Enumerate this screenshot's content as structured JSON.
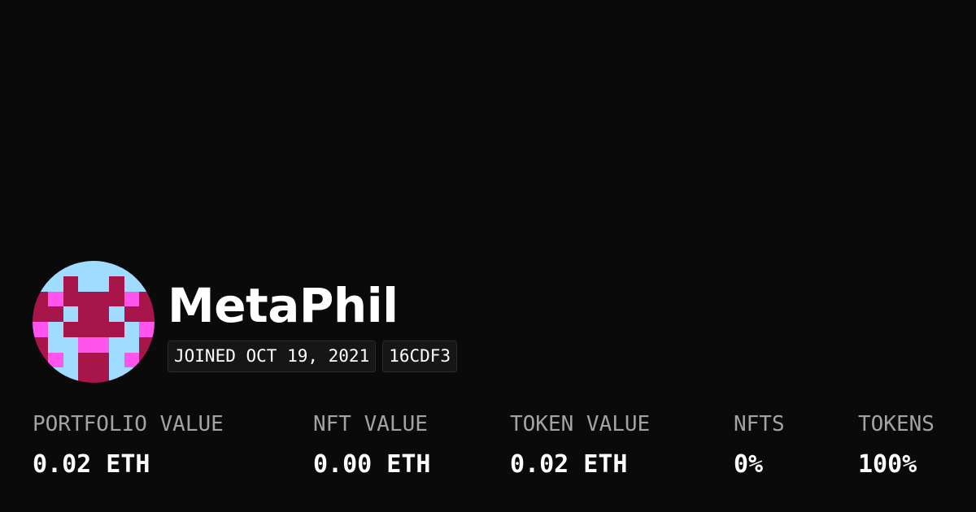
{
  "profile": {
    "name": "MetaPhil",
    "joined": "JOINED OCT 19, 2021",
    "address_tag": "16CDF3"
  },
  "avatar": {
    "icon": "pixel-identicon",
    "colors": {
      "bg": "#9fdcff",
      "dark": "#a8154a",
      "pink": "#ff55ee"
    },
    "grid": [
      "BBBBBBBB",
      "BBDBBDBB",
      "DPDDDDPD",
      "DDBDDBDD",
      "PBDDDDBP",
      "DBBPPBBD",
      "DPBDDBPD",
      "BBBDDBBB"
    ]
  },
  "stats": [
    {
      "label": "PORTFOLIO VALUE",
      "value": "0.02 ETH"
    },
    {
      "label": "NFT VALUE",
      "value": "0.00 ETH"
    },
    {
      "label": "TOKEN VALUE",
      "value": "0.02 ETH"
    },
    {
      "label": "NFTS",
      "value": "0%"
    },
    {
      "label": "TOKENS",
      "value": "100%"
    }
  ]
}
